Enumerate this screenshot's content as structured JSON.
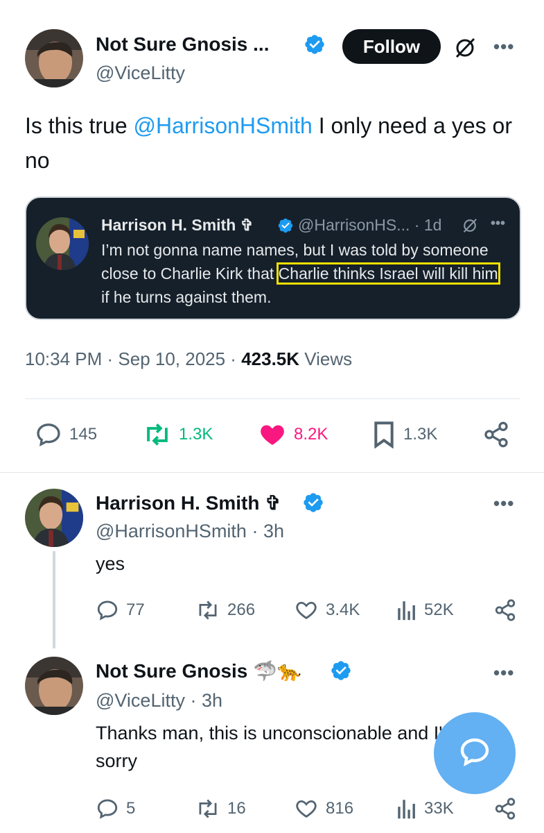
{
  "main_tweet": {
    "author_name": "Not Sure Gnosis ...",
    "handle": "@ViceLitty",
    "follow_label": "Follow",
    "text_before": "Is this true ",
    "mention": "@HarrisonHSmith",
    "text_after": " I only need a yes or no",
    "timestamp": "10:34 PM · Sep 10, 2025 · ",
    "views_count": "423.5K",
    "views_label": " Views",
    "stats": {
      "replies": "145",
      "retweets": "1.3K",
      "likes": "8.2K",
      "bookmarks": "1.3K"
    }
  },
  "quote": {
    "author_name": "Harrison H. Smith ✞",
    "handle_time": "@HarrisonHS... · 1d",
    "text_1": "I’m not gonna name names, but I was told by someone close to Charlie Kirk that ",
    "highlight_1": "Charlie thinks Israel will kill him",
    "text_2": " if he turns against them."
  },
  "replies": [
    {
      "author_name": "Harrison H. Smith ✞",
      "handle_time": "@HarrisonHSmith · 3h",
      "text": "yes",
      "stats": {
        "replies": "77",
        "retweets": "266",
        "likes": "3.4K",
        "views": "52K"
      }
    },
    {
      "author_name": "Not Sure Gnosis 🦈🐆",
      "handle_time": "@ViceLitty · 3h",
      "text": "Thanks man, this is unconscionable and I'm so sorry",
      "stats": {
        "replies": "5",
        "retweets": "16",
        "likes": "816",
        "views": "33K"
      }
    }
  ],
  "colors": {
    "accent": "#1d9bf0",
    "retweet": "#00ba7c",
    "like": "#f91880",
    "highlight": "#f4e000",
    "fab": "#63b0f2"
  },
  "icons": [
    "verified-badge-icon",
    "grok-icon",
    "more-icon",
    "reply-icon",
    "retweet-icon",
    "heart-icon",
    "bookmark-icon",
    "share-icon",
    "views-icon",
    "compose-icon"
  ]
}
